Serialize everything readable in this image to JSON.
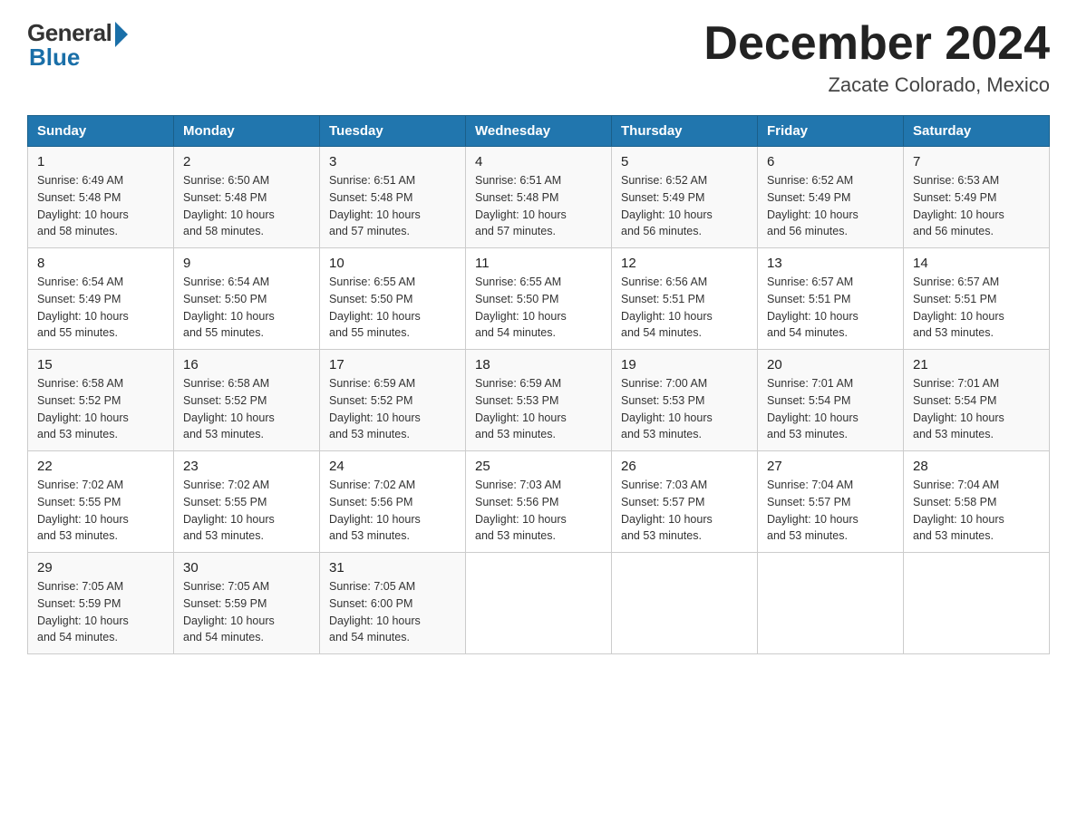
{
  "logo": {
    "general": "General",
    "blue": "Blue"
  },
  "header": {
    "title": "December 2024",
    "location": "Zacate Colorado, Mexico"
  },
  "weekdays": [
    "Sunday",
    "Monday",
    "Tuesday",
    "Wednesday",
    "Thursday",
    "Friday",
    "Saturday"
  ],
  "weeks": [
    [
      {
        "day": "1",
        "sunrise": "6:49 AM",
        "sunset": "5:48 PM",
        "daylight": "10 hours and 58 minutes."
      },
      {
        "day": "2",
        "sunrise": "6:50 AM",
        "sunset": "5:48 PM",
        "daylight": "10 hours and 58 minutes."
      },
      {
        "day": "3",
        "sunrise": "6:51 AM",
        "sunset": "5:48 PM",
        "daylight": "10 hours and 57 minutes."
      },
      {
        "day": "4",
        "sunrise": "6:51 AM",
        "sunset": "5:48 PM",
        "daylight": "10 hours and 57 minutes."
      },
      {
        "day": "5",
        "sunrise": "6:52 AM",
        "sunset": "5:49 PM",
        "daylight": "10 hours and 56 minutes."
      },
      {
        "day": "6",
        "sunrise": "6:52 AM",
        "sunset": "5:49 PM",
        "daylight": "10 hours and 56 minutes."
      },
      {
        "day": "7",
        "sunrise": "6:53 AM",
        "sunset": "5:49 PM",
        "daylight": "10 hours and 56 minutes."
      }
    ],
    [
      {
        "day": "8",
        "sunrise": "6:54 AM",
        "sunset": "5:49 PM",
        "daylight": "10 hours and 55 minutes."
      },
      {
        "day": "9",
        "sunrise": "6:54 AM",
        "sunset": "5:50 PM",
        "daylight": "10 hours and 55 minutes."
      },
      {
        "day": "10",
        "sunrise": "6:55 AM",
        "sunset": "5:50 PM",
        "daylight": "10 hours and 55 minutes."
      },
      {
        "day": "11",
        "sunrise": "6:55 AM",
        "sunset": "5:50 PM",
        "daylight": "10 hours and 54 minutes."
      },
      {
        "day": "12",
        "sunrise": "6:56 AM",
        "sunset": "5:51 PM",
        "daylight": "10 hours and 54 minutes."
      },
      {
        "day": "13",
        "sunrise": "6:57 AM",
        "sunset": "5:51 PM",
        "daylight": "10 hours and 54 minutes."
      },
      {
        "day": "14",
        "sunrise": "6:57 AM",
        "sunset": "5:51 PM",
        "daylight": "10 hours and 53 minutes."
      }
    ],
    [
      {
        "day": "15",
        "sunrise": "6:58 AM",
        "sunset": "5:52 PM",
        "daylight": "10 hours and 53 minutes."
      },
      {
        "day": "16",
        "sunrise": "6:58 AM",
        "sunset": "5:52 PM",
        "daylight": "10 hours and 53 minutes."
      },
      {
        "day": "17",
        "sunrise": "6:59 AM",
        "sunset": "5:52 PM",
        "daylight": "10 hours and 53 minutes."
      },
      {
        "day": "18",
        "sunrise": "6:59 AM",
        "sunset": "5:53 PM",
        "daylight": "10 hours and 53 minutes."
      },
      {
        "day": "19",
        "sunrise": "7:00 AM",
        "sunset": "5:53 PM",
        "daylight": "10 hours and 53 minutes."
      },
      {
        "day": "20",
        "sunrise": "7:01 AM",
        "sunset": "5:54 PM",
        "daylight": "10 hours and 53 minutes."
      },
      {
        "day": "21",
        "sunrise": "7:01 AM",
        "sunset": "5:54 PM",
        "daylight": "10 hours and 53 minutes."
      }
    ],
    [
      {
        "day": "22",
        "sunrise": "7:02 AM",
        "sunset": "5:55 PM",
        "daylight": "10 hours and 53 minutes."
      },
      {
        "day": "23",
        "sunrise": "7:02 AM",
        "sunset": "5:55 PM",
        "daylight": "10 hours and 53 minutes."
      },
      {
        "day": "24",
        "sunrise": "7:02 AM",
        "sunset": "5:56 PM",
        "daylight": "10 hours and 53 minutes."
      },
      {
        "day": "25",
        "sunrise": "7:03 AM",
        "sunset": "5:56 PM",
        "daylight": "10 hours and 53 minutes."
      },
      {
        "day": "26",
        "sunrise": "7:03 AM",
        "sunset": "5:57 PM",
        "daylight": "10 hours and 53 minutes."
      },
      {
        "day": "27",
        "sunrise": "7:04 AM",
        "sunset": "5:57 PM",
        "daylight": "10 hours and 53 minutes."
      },
      {
        "day": "28",
        "sunrise": "7:04 AM",
        "sunset": "5:58 PM",
        "daylight": "10 hours and 53 minutes."
      }
    ],
    [
      {
        "day": "29",
        "sunrise": "7:05 AM",
        "sunset": "5:59 PM",
        "daylight": "10 hours and 54 minutes."
      },
      {
        "day": "30",
        "sunrise": "7:05 AM",
        "sunset": "5:59 PM",
        "daylight": "10 hours and 54 minutes."
      },
      {
        "day": "31",
        "sunrise": "7:05 AM",
        "sunset": "6:00 PM",
        "daylight": "10 hours and 54 minutes."
      },
      null,
      null,
      null,
      null
    ]
  ],
  "labels": {
    "sunrise": "Sunrise:",
    "sunset": "Sunset:",
    "daylight": "Daylight:"
  }
}
